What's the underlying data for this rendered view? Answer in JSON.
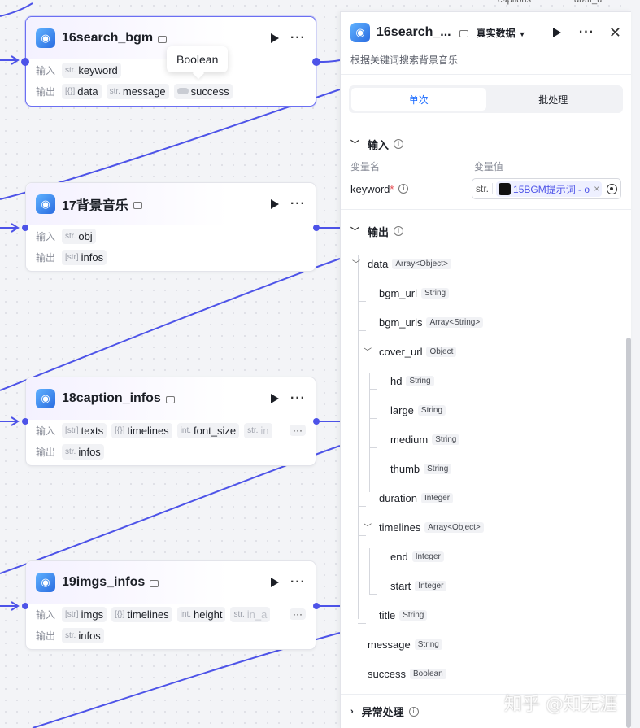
{
  "nodes": [
    {
      "title": "16search_bgm",
      "input_label": "输入",
      "output_label": "输出",
      "inputs": [
        {
          "type": "str.",
          "name": "keyword"
        }
      ],
      "outputs": [
        {
          "type": "[{}]",
          "name": "data"
        },
        {
          "type": "str.",
          "name": "message"
        },
        {
          "type": "toggle",
          "name": "success"
        }
      ]
    },
    {
      "title": "17背景音乐",
      "input_label": "输入",
      "output_label": "输出",
      "inputs": [
        {
          "type": "str.",
          "name": "obj"
        }
      ],
      "outputs": [
        {
          "type": "[str]",
          "name": "infos"
        }
      ]
    },
    {
      "title": "18caption_infos",
      "input_label": "输入",
      "output_label": "输出",
      "inputs": [
        {
          "type": "[str]",
          "name": "texts"
        },
        {
          "type": "[{}]",
          "name": "timelines"
        },
        {
          "type": "int.",
          "name": "font_size"
        },
        {
          "type": "str.",
          "name": "in"
        }
      ],
      "outputs": [
        {
          "type": "str.",
          "name": "infos"
        }
      ]
    },
    {
      "title": "19imgs_infos",
      "input_label": "输入",
      "output_label": "输出",
      "inputs": [
        {
          "type": "[str]",
          "name": "imgs"
        },
        {
          "type": "[{}]",
          "name": "timelines"
        },
        {
          "type": "int.",
          "name": "height"
        },
        {
          "type": "str.",
          "name": "in_a"
        }
      ],
      "outputs": [
        {
          "type": "str.",
          "name": "infos"
        }
      ]
    }
  ],
  "tooltip": "Boolean",
  "more_label": "···",
  "panel": {
    "title": "16search_...",
    "data_mode": "真实数据",
    "description": "根据关键词搜索背景音乐",
    "tabs": [
      "单次",
      "批处理"
    ],
    "input_section": "输入",
    "col_name": "变量名",
    "col_value": "变量值",
    "keyword_label": "keyword",
    "required_mark": "*",
    "value_type": "str.",
    "value_text": "15BGM提示词 - o",
    "output_section": "输出",
    "tree": [
      {
        "name": "data",
        "type": "Array<Object>"
      },
      {
        "name": "bgm_url",
        "type": "String"
      },
      {
        "name": "bgm_urls",
        "type": "Array<String>"
      },
      {
        "name": "cover_url",
        "type": "Object"
      },
      {
        "name": "hd",
        "type": "String"
      },
      {
        "name": "large",
        "type": "String"
      },
      {
        "name": "medium",
        "type": "String"
      },
      {
        "name": "thumb",
        "type": "String"
      },
      {
        "name": "duration",
        "type": "Integer"
      },
      {
        "name": "timelines",
        "type": "Array<Object>"
      },
      {
        "name": "end",
        "type": "Integer"
      },
      {
        "name": "start",
        "type": "Integer"
      },
      {
        "name": "title",
        "type": "String"
      },
      {
        "name": "message",
        "type": "String"
      },
      {
        "name": "success",
        "type": "Boolean"
      }
    ],
    "exception_section": "异常处理"
  },
  "background_fragments": [
    "captions",
    "draft_ur"
  ],
  "watermark": "知乎 @知无涯",
  "colors": {
    "accent": "#4d53e8",
    "tab_active": "#1a6aff",
    "required": "#e5484d"
  }
}
